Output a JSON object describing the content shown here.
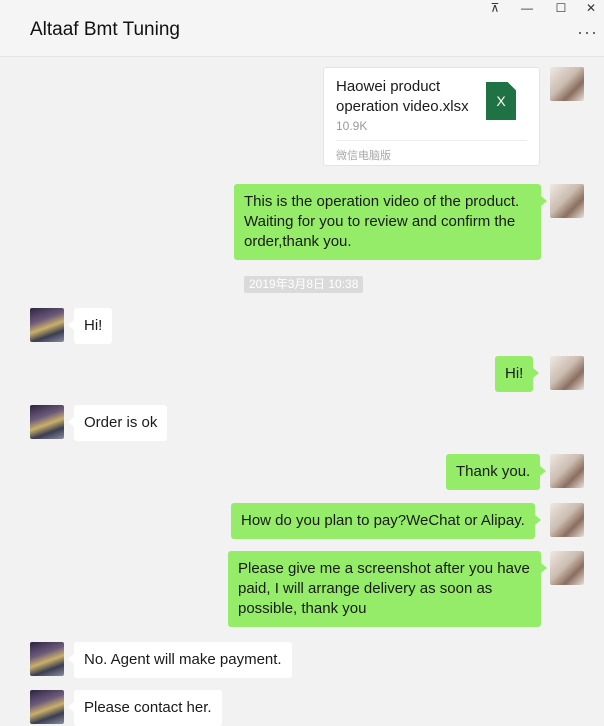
{
  "window": {
    "title": "Altaaf Bmt Tuning",
    "controls": {
      "pin": "⊼",
      "minimize": "—",
      "maximize": "☐",
      "close": "✕"
    },
    "more_label": "···"
  },
  "file_message": {
    "file_name": "Haowei product operation video.xlsx",
    "file_size": "10.9K",
    "source": "微信电脑版",
    "icon_letter": "X",
    "icon_name": "excel-file-icon"
  },
  "messages": [
    {
      "sender": "me",
      "text": "This is the operation video of the product. Waiting for you to review and confirm the order,thank you."
    },
    {
      "sender": "other",
      "text": "Hi!"
    },
    {
      "sender": "me",
      "text": "Hi!"
    },
    {
      "sender": "other",
      "text": "Order is ok"
    },
    {
      "sender": "me",
      "text": "Thank you."
    },
    {
      "sender": "me",
      "text": "How do you plan to pay?WeChat or Alipay."
    },
    {
      "sender": "me",
      "text": "Please give me a screenshot after you have paid, I will arrange delivery as soon as possible, thank you"
    },
    {
      "sender": "other",
      "text": "No. Agent will make payment."
    },
    {
      "sender": "other",
      "text": "Please contact her."
    }
  ],
  "timestamp": "2019年3月8日 10:38",
  "colors": {
    "my_bubble": "#95ec69",
    "other_bubble": "#ffffff",
    "background": "#f2f2f2",
    "excel_green": "#1f7244"
  }
}
